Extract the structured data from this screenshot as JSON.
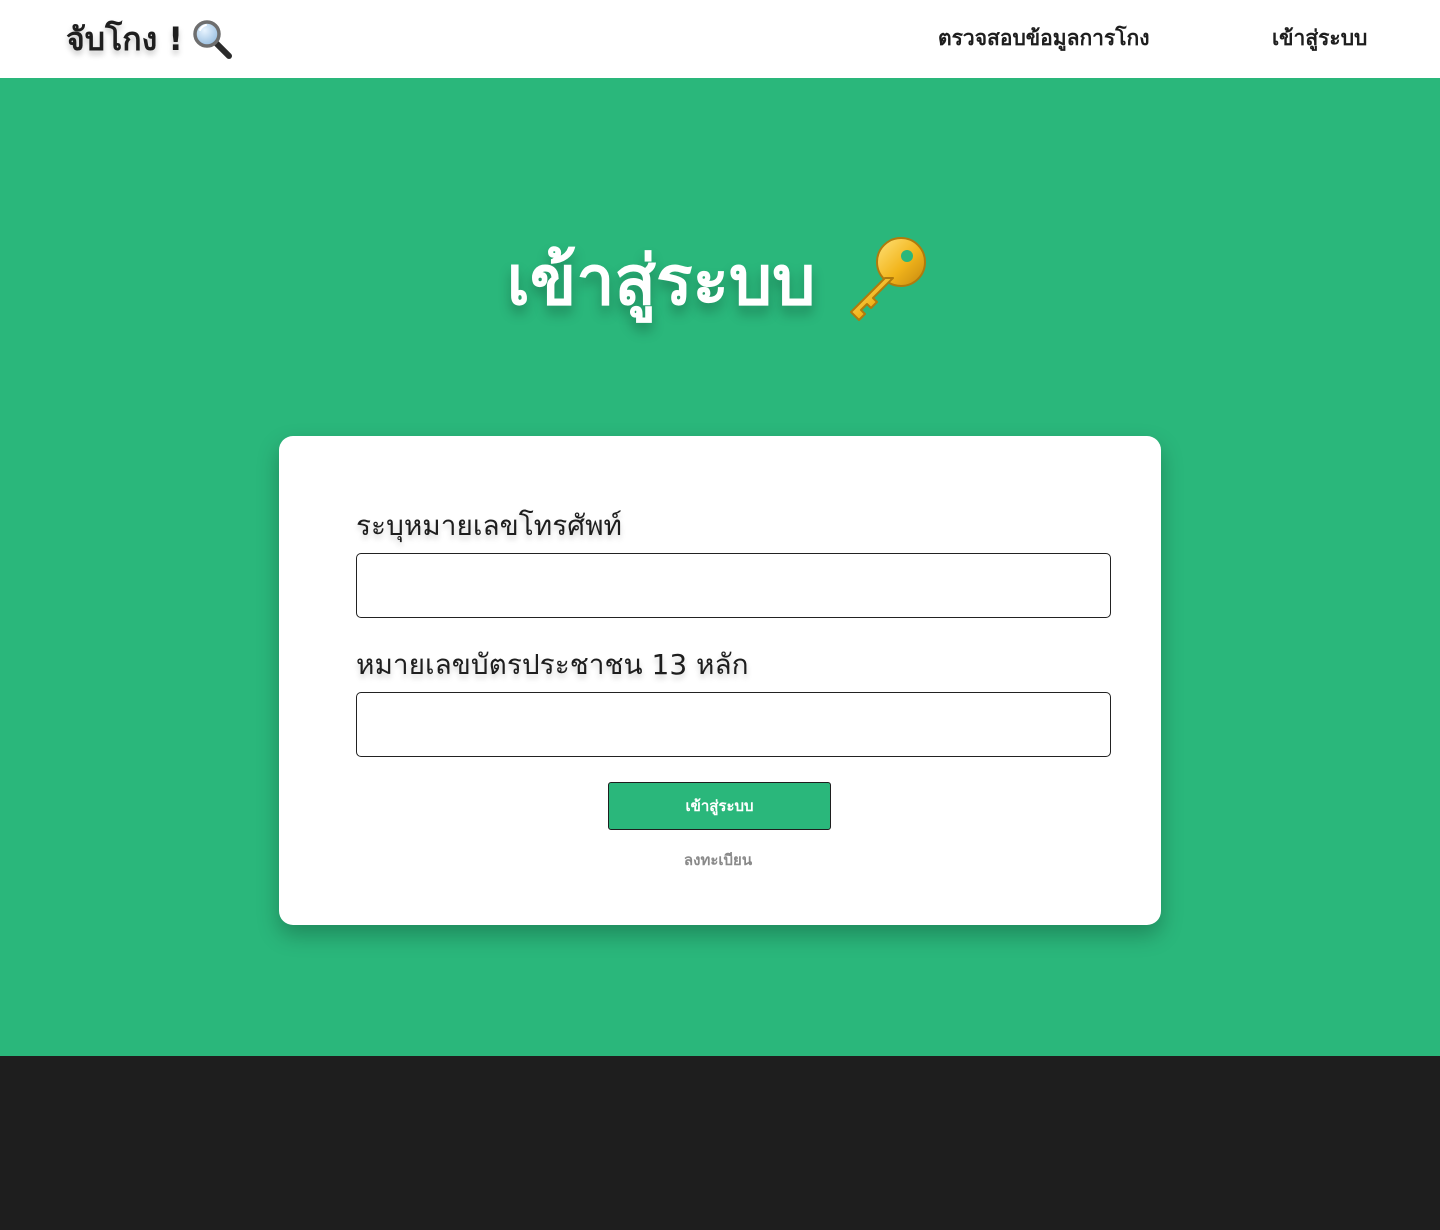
{
  "navbar": {
    "brand_text": "จับโกง !",
    "brand_icon": "magnifying-glass-icon",
    "links": {
      "check": "ตรวจสอบข้อมูลการโกง",
      "login": "เข้าสู่ระบบ"
    }
  },
  "hero": {
    "title": "เข้าสู่ระบบ",
    "title_icon": "key-icon"
  },
  "form": {
    "phone_label": "ระบุหมายเลขโทรศัพท์",
    "phone_value": "",
    "id_label": "หมายเลขบัตรประชาชน 13 หลัก",
    "id_value": "",
    "submit_label": "เข้าสู่ระบบ",
    "register_label": "ลงทะเบียน"
  },
  "colors": {
    "primary_green": "#2ab77b",
    "footer_dark": "#1e1e1e",
    "text_dark": "#1e1e1e",
    "muted_gray": "#8a8a8a"
  }
}
